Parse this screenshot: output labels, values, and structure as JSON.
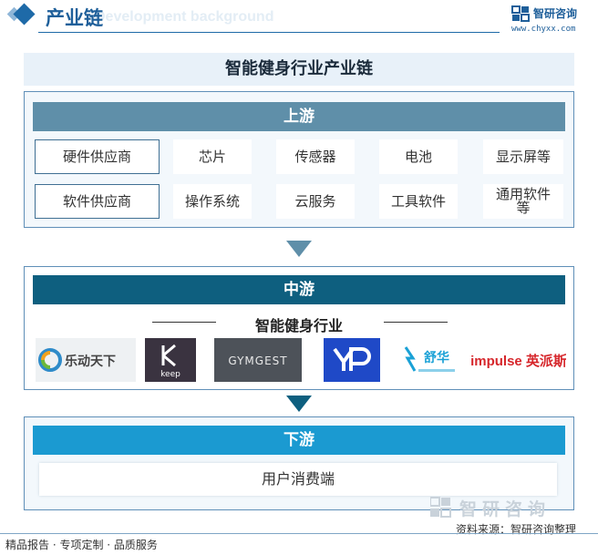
{
  "header": {
    "title": "产业链",
    "ghost_text": "Development background",
    "brand_name": "智研咨询",
    "brand_site": "www.chyxx.com",
    "accent_color": "#1e6aa8"
  },
  "main_title": "智能健身行业产业链",
  "upstream": {
    "label": "上游",
    "color": "#5f8fa9",
    "rows": [
      [
        "硬件供应商",
        "芯片",
        "传感器",
        "电池",
        "显示屏等"
      ],
      [
        "软件供应商",
        "操作系统",
        "云服务",
        "工具软件",
        "通用软件等"
      ]
    ]
  },
  "midstream": {
    "label": "中游",
    "color": "#0e5f7f",
    "industry_label": "智能健身行业",
    "logos": [
      {
        "name": "乐动天下",
        "icon": "ledong-logo"
      },
      {
        "name": "keep",
        "icon": "keep-logo"
      },
      {
        "name": "GYMGEST",
        "icon": "gymgest-logo"
      },
      {
        "name": "YP",
        "icon": "yp-logo"
      },
      {
        "name": "舒华",
        "icon": "shuhua-logo"
      },
      {
        "name": "impulse 英派斯",
        "icon": "impulse-logo"
      }
    ]
  },
  "downstream": {
    "label": "下游",
    "color": "#1b9ad1",
    "item": "用户消费端"
  },
  "footer": {
    "left_text": "精品报告 · 专项定制 · 品质服务",
    "source_text": "资料来源：智研咨询整理",
    "watermark_brand": "智研咨询"
  }
}
